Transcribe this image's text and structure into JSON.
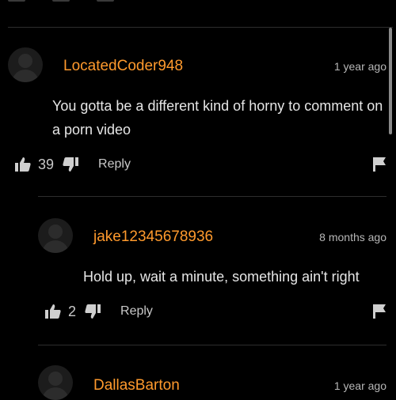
{
  "comments": [
    {
      "username": "LocatedCoder948",
      "timestamp": "1 year ago",
      "text": "You gotta be a different kind of horny to comment on a porn video",
      "likes": "39",
      "reply_label": "Reply"
    },
    {
      "username": "jake12345678936",
      "timestamp": "8 months ago",
      "text": "Hold up, wait a minute, something ain't right",
      "likes": "2",
      "reply_label": "Reply"
    },
    {
      "username": "DallasBarton",
      "timestamp": "1 year ago"
    }
  ],
  "colors": {
    "background": "#000000",
    "username": "#ff9a2d",
    "divider": "#2d2d2d",
    "text": "#e6e6e6"
  },
  "icons": [
    "thumbs-up-icon",
    "thumbs-down-icon",
    "flag-icon",
    "avatar-placeholder"
  ]
}
